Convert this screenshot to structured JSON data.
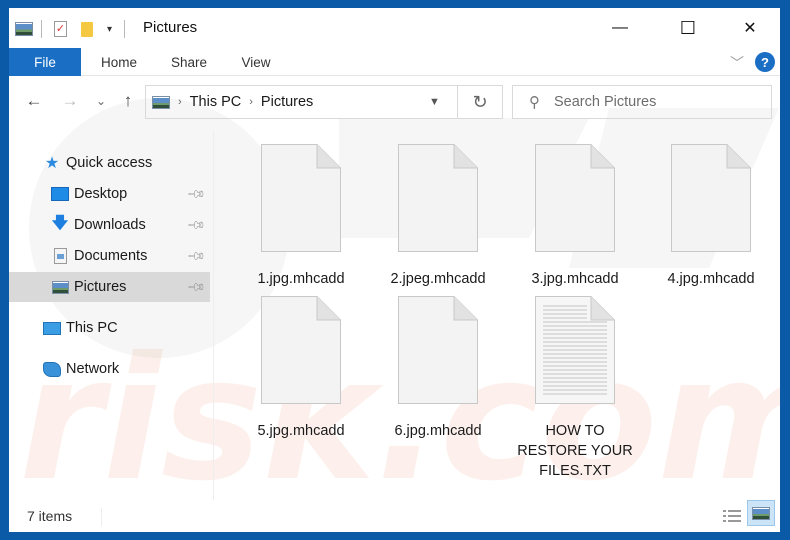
{
  "window": {
    "title": "Pictures",
    "controls": {
      "minimize": "—",
      "maximize": "☐",
      "close": "✕"
    }
  },
  "ribbon": {
    "tabs": [
      {
        "label": "File",
        "active": true
      },
      {
        "label": "Home"
      },
      {
        "label": "Share"
      },
      {
        "label": "View"
      }
    ],
    "help": "?"
  },
  "navigation": {
    "back": "←",
    "forward": "→",
    "recent": "⌄",
    "up": "↑",
    "breadcrumb": [
      "This PC",
      "Pictures"
    ],
    "breadcrumb_separator": "›",
    "refresh": "↻",
    "search_placeholder": "Search Pictures"
  },
  "sidebar": {
    "quick_access": {
      "label": "Quick access",
      "icon": "star-icon"
    },
    "items": [
      {
        "label": "Desktop",
        "icon": "desktop-icon",
        "pinned": true
      },
      {
        "label": "Downloads",
        "icon": "downloads-icon",
        "pinned": true
      },
      {
        "label": "Documents",
        "icon": "documents-icon",
        "pinned": true
      },
      {
        "label": "Pictures",
        "icon": "pictures-icon",
        "pinned": true,
        "selected": true
      }
    ],
    "this_pc": {
      "label": "This PC",
      "icon": "computer-icon"
    },
    "network": {
      "label": "Network",
      "icon": "network-icon"
    }
  },
  "files": [
    {
      "name": "1.jpg.mhcadd",
      "type": "blank"
    },
    {
      "name": "2.jpeg.mhcadd",
      "type": "blank"
    },
    {
      "name": "3.jpg.mhcadd",
      "type": "blank"
    },
    {
      "name": "4.jpg.mhcadd",
      "type": "blank"
    },
    {
      "name": "5.jpg.mhcadd",
      "type": "blank"
    },
    {
      "name": "6.jpg.mhcadd",
      "type": "blank"
    },
    {
      "name": "HOW TO RESTORE YOUR FILES.TXT",
      "type": "text",
      "label_lines": [
        "HOW TO",
        "RESTORE YOUR",
        "FILES.TXT"
      ]
    }
  ],
  "status": {
    "item_count": "7 items",
    "view_mode": "large-icons"
  },
  "colors": {
    "frame": "#0b5aa8",
    "accent": "#1a6fc4",
    "selected_bg": "#d9d9d9"
  }
}
